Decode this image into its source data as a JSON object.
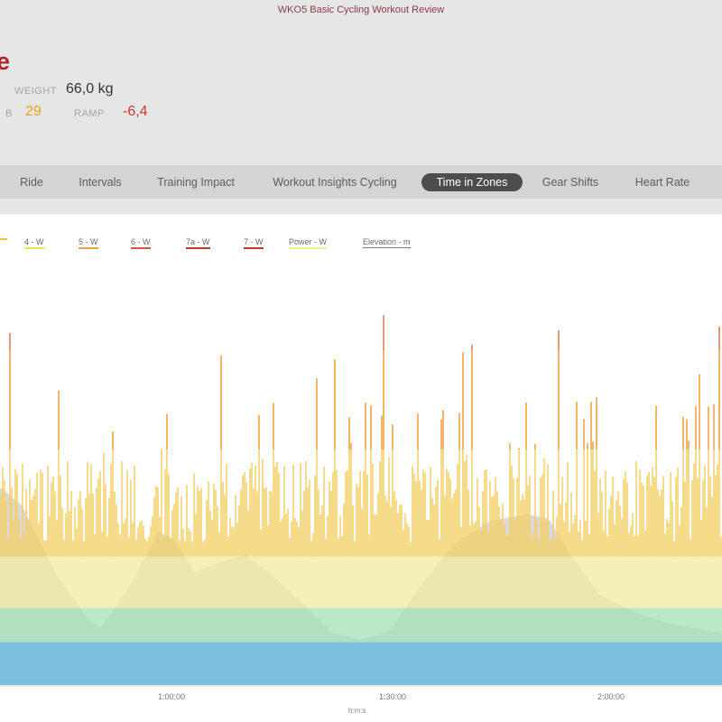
{
  "header": {
    "app_title": "WKO5 Basic Cycling Workout Review",
    "workout_name_fragment": "e",
    "metrics": {
      "weight_label": "WEIGHT",
      "weight_value": "66,0 kg",
      "tsb_fragment": "B",
      "tsb_value": "29",
      "ramp_label": "RAMP",
      "ramp_value": "-6,4"
    }
  },
  "tabs": [
    {
      "label": "Ride",
      "active": false
    },
    {
      "label": "Intervals",
      "active": false
    },
    {
      "label": "Training Impact",
      "active": false
    },
    {
      "label": "Workout Insights Cycling",
      "active": false
    },
    {
      "label": "Time in Zones",
      "active": true
    },
    {
      "label": "Gear Shifts",
      "active": false
    },
    {
      "label": "Heart Rate",
      "active": false
    }
  ],
  "legend": [
    {
      "label": "",
      "color": "#f2c230"
    },
    {
      "label": "4 - W",
      "color": "#f4e04d"
    },
    {
      "label": "5 - W",
      "color": "#f0a040"
    },
    {
      "label": "6 - W",
      "color": "#d9534f"
    },
    {
      "label": "7a - W",
      "color": "#c0392b"
    },
    {
      "label": "7 - W",
      "color": "#c0392b"
    },
    {
      "label": "Power - W",
      "color": "#f3ee8a"
    },
    {
      "label": "Elevation - m",
      "color": "#777777"
    }
  ],
  "chart_data": {
    "type": "area",
    "x_ticks": [
      "1:00:00",
      "1:30:00",
      "2:00:00"
    ],
    "xlabel": "h:m:s",
    "elevation_profile": [
      [
        0.0,
        0.7
      ],
      [
        0.03,
        0.62
      ],
      [
        0.08,
        0.3
      ],
      [
        0.12,
        0.12
      ],
      [
        0.14,
        0.07
      ],
      [
        0.18,
        0.26
      ],
      [
        0.22,
        0.5
      ],
      [
        0.24,
        0.47
      ],
      [
        0.27,
        0.32
      ],
      [
        0.3,
        0.36
      ],
      [
        0.34,
        0.4
      ],
      [
        0.38,
        0.3
      ],
      [
        0.42,
        0.18
      ],
      [
        0.46,
        0.05
      ],
      [
        0.5,
        0.02
      ],
      [
        0.54,
        0.06
      ],
      [
        0.58,
        0.25
      ],
      [
        0.63,
        0.45
      ],
      [
        0.68,
        0.55
      ],
      [
        0.73,
        0.58
      ],
      [
        0.76,
        0.56
      ],
      [
        0.79,
        0.4
      ],
      [
        0.83,
        0.22
      ],
      [
        0.88,
        0.14
      ],
      [
        0.93,
        0.09
      ],
      [
        1.0,
        0.05
      ]
    ],
    "zone_colors": {
      "z1": "#5bb7e0",
      "z2": "#a6e0b8",
      "z3": "#f1e9a0",
      "z4": "#f3cf63",
      "z5": "#ef9d3c",
      "z6": "#d77a5a",
      "z7": "#c45a6a"
    },
    "colors": {
      "elevation": "#d2d2d2",
      "power": "#f7f1c4"
    }
  }
}
